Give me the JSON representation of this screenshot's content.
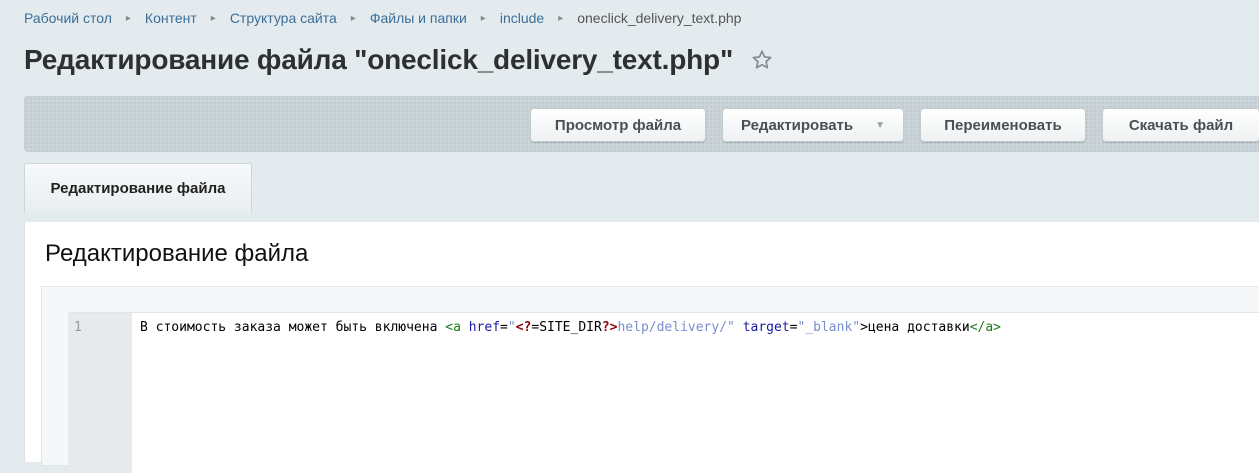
{
  "breadcrumb": {
    "items": [
      "Рабочий стол",
      "Контент",
      "Структура сайта",
      "Файлы и папки",
      "include"
    ],
    "current": "oneclick_delivery_text.php"
  },
  "page": {
    "title": "Редактирование файла \"oneclick_delivery_text.php\""
  },
  "toolbar": {
    "view_label": "Просмотр файла",
    "edit_label": "Редактировать",
    "rename_label": "Переименовать",
    "download_label": "Скачать файл"
  },
  "tabs": [
    {
      "label": "Редактирование файла"
    }
  ],
  "section": {
    "title": "Редактирование файла"
  },
  "editor": {
    "line_number": "1",
    "code": {
      "text_before": "В стоимость заказа может быть включена ",
      "tag_open": "<a",
      "attr_href": " href",
      "eq1": "=",
      "str_q1": "\"",
      "php_open": "<?",
      "php_eq": "=",
      "php_const": "SITE_DIR",
      "php_close": "?>",
      "str_rest1": "help/delivery/\"",
      "attr_target": " target",
      "eq2": "=",
      "str_target": "\"_blank\"",
      "tag_gt": ">",
      "link_text": "цена доставки",
      "tag_close": "</a>"
    }
  },
  "colors": {
    "breadcrumb_link": "#3c6e98",
    "background": "#e4ebee",
    "tag": "#1c7c1c",
    "attribute": "#1a1aa6",
    "string": "#7a8fcf"
  },
  "icons": {
    "favorite": "star-icon",
    "dropdown": "chevron-down-icon"
  }
}
